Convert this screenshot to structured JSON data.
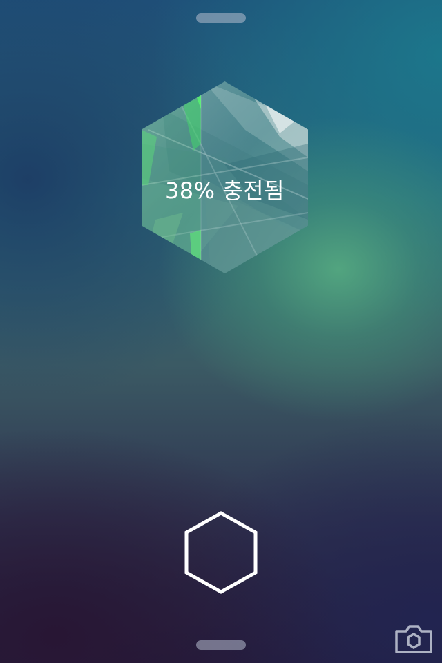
{
  "lock_screen": {
    "battery": {
      "label": "38% 충전됨",
      "level_percent": 38
    },
    "icons": {
      "home": "hexagon-outline-icon",
      "camera": "camera-icon"
    },
    "colors": {
      "charge_fill": "#3fcf63",
      "hex_tint": "#6fa8a6",
      "icon_stroke": "#ffffff"
    }
  }
}
